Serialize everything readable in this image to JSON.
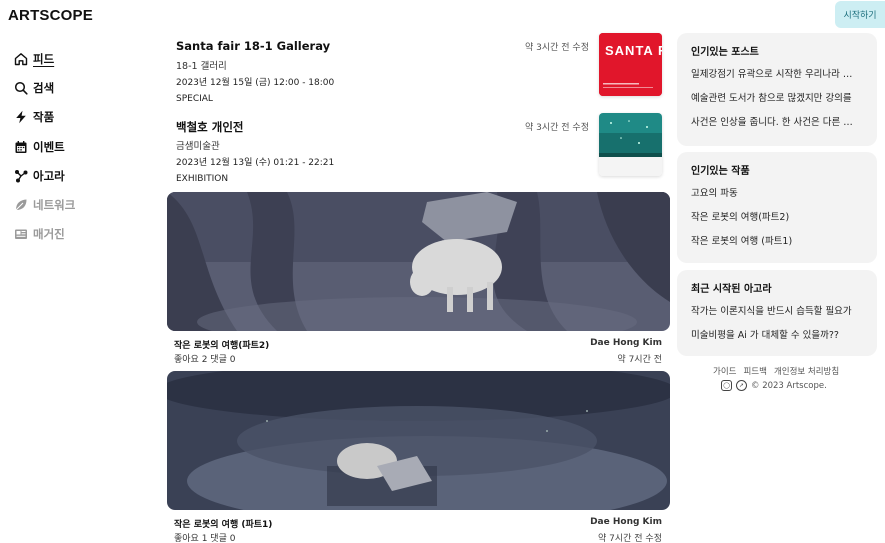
{
  "header": {
    "logo": "ARTSCOPE",
    "start_button": "시작하기"
  },
  "sidebar": {
    "items": [
      {
        "label": "피드",
        "icon": "home-icon",
        "active": true,
        "disabled": false
      },
      {
        "label": "검색",
        "icon": "search-icon",
        "active": false,
        "disabled": false
      },
      {
        "label": "작품",
        "icon": "lightning-icon",
        "active": false,
        "disabled": false
      },
      {
        "label": "이벤트",
        "icon": "calendar-icon",
        "active": false,
        "disabled": false
      },
      {
        "label": "아고라",
        "icon": "graph-icon",
        "active": false,
        "disabled": false
      },
      {
        "label": "네트워크",
        "icon": "leaf-icon",
        "active": false,
        "disabled": true
      },
      {
        "label": "매거진",
        "icon": "newspaper-icon",
        "active": false,
        "disabled": true
      }
    ]
  },
  "events": [
    {
      "title": "Santa fair 18-1 Galleray",
      "venue": "18-1 갤러리",
      "date": "2023년 12월 15일 (금) 12:00 - 18:00",
      "category": "SPECIAL",
      "time": "약 3시간 전 수정",
      "thumb_text": "SANTA FAIR"
    },
    {
      "title": "백철호 개인전",
      "venue": "금샘미술관",
      "date": "2023년 12월 13일 (수) 01:21 - 22:21",
      "category": "EXHIBITION",
      "time": "약 3시간 전 수정"
    }
  ],
  "works": [
    {
      "title": "작은 로봇의 여행(파트2)",
      "stats": "좋아요 2  댓글 0",
      "author": "Dae Hong Kim",
      "time": "약 7시간 전"
    },
    {
      "title": "작은 로봇의 여행 (파트1)",
      "stats": "좋아요 1  댓글 0",
      "author": "Dae Hong Kim",
      "time": "약 7시간 전 수정"
    }
  ],
  "panels": {
    "posts": {
      "title": "인기있는 포스트",
      "items": [
        "일제강점기 유곽으로 시작한 우리나라 …",
        "예술관련 도서가 참으로 많겠지만 강의를",
        "사건은 인상을 줍니다. 한 사건은 다른 …"
      ]
    },
    "works": {
      "title": "인기있는 작품",
      "items": [
        "고요의 파동",
        "작은 로봇의 여행(파트2)",
        "작은 로봇의 여행 (파트1)"
      ]
    },
    "agora": {
      "title": "최근 시작된 아고라",
      "items": [
        "작가는 이론지식을 반드시 습득할 필요가",
        "미술비평을 Ai 가 대체할 수 있을까??"
      ]
    }
  },
  "footer": {
    "links": [
      "가이드",
      "피드백",
      "개인정보 처리방침"
    ],
    "copyright": "© 2023 Artscope."
  },
  "colors": {
    "accent": "#cdeef3",
    "panel_bg": "#f3f3f3",
    "santa_red": "#e1162b",
    "teal": "#1f8a86"
  }
}
